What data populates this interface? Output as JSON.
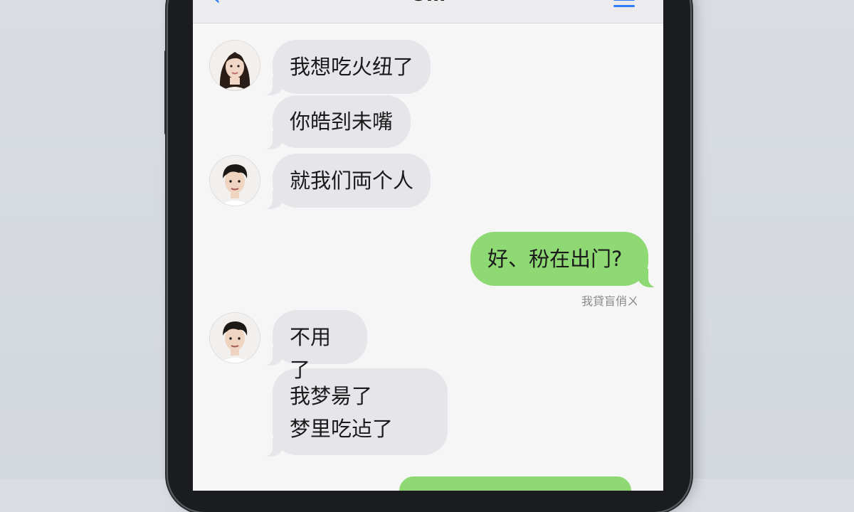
{
  "navbar": {
    "back_icon": "chevron-left-icon",
    "title": "Om",
    "menu_icon": "menu-icon"
  },
  "colors": {
    "accent": "#2f7cf6",
    "incoming_bubble": "#e5e5ea",
    "outgoing_bubble": "#8fd975",
    "background": "#f6f6f7"
  },
  "messages": [
    {
      "sender": "her",
      "lines": [
        "我想吃火纽了"
      ]
    },
    {
      "sender": "her",
      "lines": [
        "你皓刭未嘴"
      ]
    },
    {
      "sender": "him",
      "lines": [
        "就我们両个人"
      ]
    },
    {
      "sender": "me",
      "lines": [
        "好、秎在出门?"
      ]
    },
    {
      "sender": "him",
      "lines": [
        "不用了"
      ]
    },
    {
      "sender": "him",
      "lines": [
        "我梦昜了",
        "梦里吃迠了"
      ]
    }
  ],
  "delivery_status": "我貸盲俏ㄨ"
}
